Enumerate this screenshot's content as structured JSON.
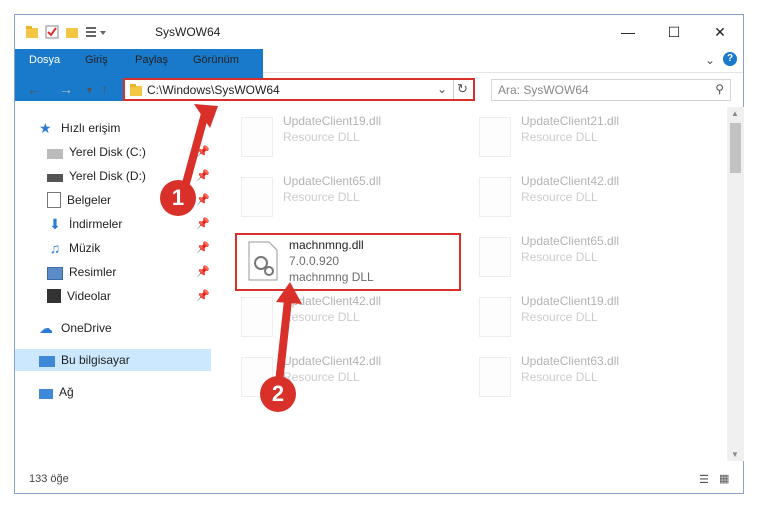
{
  "window": {
    "title": "SysWOW64"
  },
  "ribbon": {
    "tabs": [
      "Dosya",
      "Giriş",
      "Paylaş",
      "Görünüm"
    ]
  },
  "address": {
    "path": "C:\\Windows\\SysWOW64"
  },
  "search": {
    "placeholder": "Ara: SysWOW64"
  },
  "sidebar": {
    "items": [
      {
        "label": "Hızlı erişim"
      },
      {
        "label": "Yerel Disk (C:)"
      },
      {
        "label": "Yerel Disk (D:)"
      },
      {
        "label": "Belgeler"
      },
      {
        "label": "İndirmeler"
      },
      {
        "label": "Müzik"
      },
      {
        "label": "Resimler"
      },
      {
        "label": "Videolar"
      },
      {
        "label": "OneDrive"
      },
      {
        "label": "Bu bilgisayar"
      },
      {
        "label": "Ağ"
      }
    ]
  },
  "files": [
    {
      "name": "UpdateClient19.dll",
      "type": "Resource DLL"
    },
    {
      "name": "UpdateClient21.dll",
      "type": "Resource DLL"
    },
    {
      "name": "UpdateClient65.dll",
      "type": "Resource DLL"
    },
    {
      "name": "UpdateClient42.dll",
      "type": "Resource DLL"
    },
    {
      "name": "machnmng.dll",
      "version": "7.0.0.920",
      "type": "machnmng DLL"
    },
    {
      "name": "UpdateClient65.dll",
      "type": "Resource DLL"
    },
    {
      "name": "UpdateClient42.dll",
      "type": "Resource DLL"
    },
    {
      "name": "UpdateClient19.dll",
      "type": "Resource DLL"
    },
    {
      "name": "UpdateClient42.dll",
      "type": "Resource DLL"
    },
    {
      "name": "UpdateClient63.dll",
      "type": "Resource DLL"
    }
  ],
  "status": {
    "count": "133 öğe"
  },
  "annotations": {
    "step1": "1",
    "step2": "2"
  },
  "colors": {
    "accent": "#1979ca",
    "highlight": "#d9312a"
  }
}
